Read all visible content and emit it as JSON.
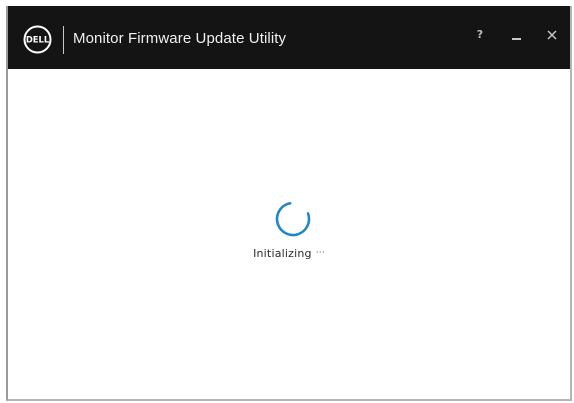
{
  "window": {
    "title": "Monitor Firmware Update Utility",
    "logo_text": "DELL"
  },
  "titlebar": {
    "help_label": "?",
    "minimize_icon": "minimize-icon",
    "close_icon": "close-icon"
  },
  "main": {
    "status_text": "Initializing",
    "status_suffix": "···",
    "spinner_icon": "loading-spinner-icon"
  },
  "colors": {
    "titlebar_bg": "#141414",
    "title_text": "#f0f0f0",
    "spinner_accent": "#1d87c9",
    "background": "#ffffff"
  }
}
